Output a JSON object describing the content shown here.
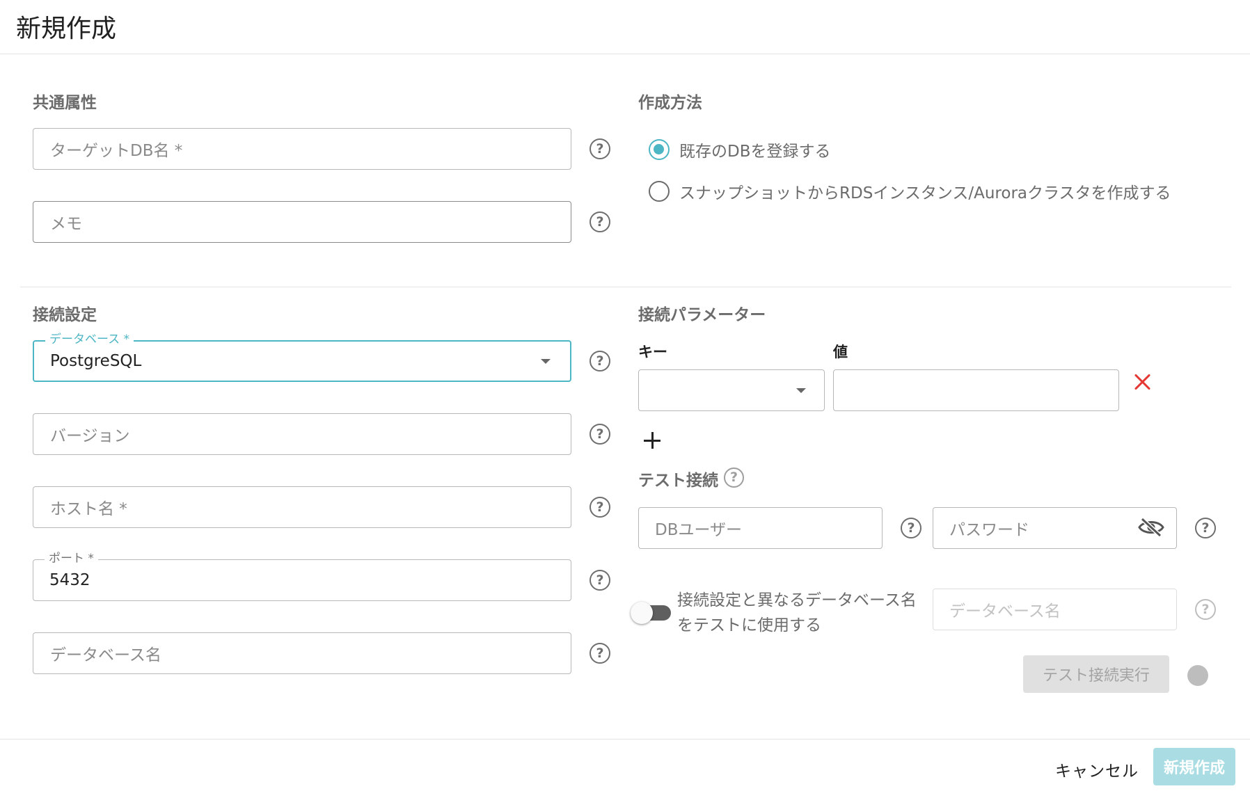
{
  "dialog": {
    "title": "新規作成"
  },
  "common": {
    "title": "共通属性",
    "target_db_placeholder": "ターゲットDB名 *",
    "memo_placeholder": "メモ"
  },
  "method": {
    "title": "作成方法",
    "options": [
      {
        "label": "既存のDBを登録する",
        "checked": true
      },
      {
        "label": "スナップショットからRDSインスタンス/Auroraクラスタを作成する",
        "checked": false
      }
    ]
  },
  "connection": {
    "title": "接続設定",
    "database_label": "データベース *",
    "database_value": "PostgreSQL",
    "version_placeholder": "バージョン",
    "host_placeholder": "ホスト名 *",
    "port_label": "ポート *",
    "port_value": "5432",
    "dbname_placeholder": "データベース名"
  },
  "params": {
    "title": "接続パラメーター",
    "key_label": "キー",
    "value_label": "値",
    "key_value": "",
    "value_value": ""
  },
  "test": {
    "title": "テスト接続",
    "db_user_placeholder": "DBユーザー",
    "password_placeholder": "パスワード",
    "toggle_label": "接続設定と異なるデータベース名をテストに使用する",
    "toggle_on": false,
    "alt_dbname_placeholder": "データベース名",
    "run_label": "テスト接続実行"
  },
  "footer": {
    "cancel_label": "キャンセル",
    "create_label": "新規作成"
  },
  "colors": {
    "accent": "#4db6c4",
    "danger": "#e53935",
    "primary_disabled": "#a9dde3"
  }
}
